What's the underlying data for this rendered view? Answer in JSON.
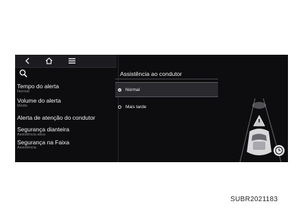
{
  "toolbar": {
    "icons": [
      "back-icon",
      "home-icon",
      "menu-icon"
    ]
  },
  "search": {
    "icon": "search-icon"
  },
  "menu": {
    "items": [
      {
        "label": "Tempo do alerta",
        "sub": "Normal"
      },
      {
        "label": "Volume do alerta",
        "sub": "Médio"
      },
      {
        "label": "Alerta de atenção do condutor",
        "sub": ""
      },
      {
        "label": "Segurança dianteira",
        "sub": "Assistência ativa"
      },
      {
        "label": "Segurança na Faixa",
        "sub": "Assistência"
      }
    ]
  },
  "panel": {
    "title": "Assistência ao condutor",
    "options": [
      {
        "label": "Normal",
        "selected": true
      },
      {
        "label": "Mais tarde",
        "selected": false
      }
    ]
  },
  "colors": {
    "screen_bg": "#0d0d0f",
    "selected_bg": "#2a2a2e",
    "text": "#f2f2f2",
    "subtext": "#8d8d92"
  },
  "caption": "SUBR2021183"
}
